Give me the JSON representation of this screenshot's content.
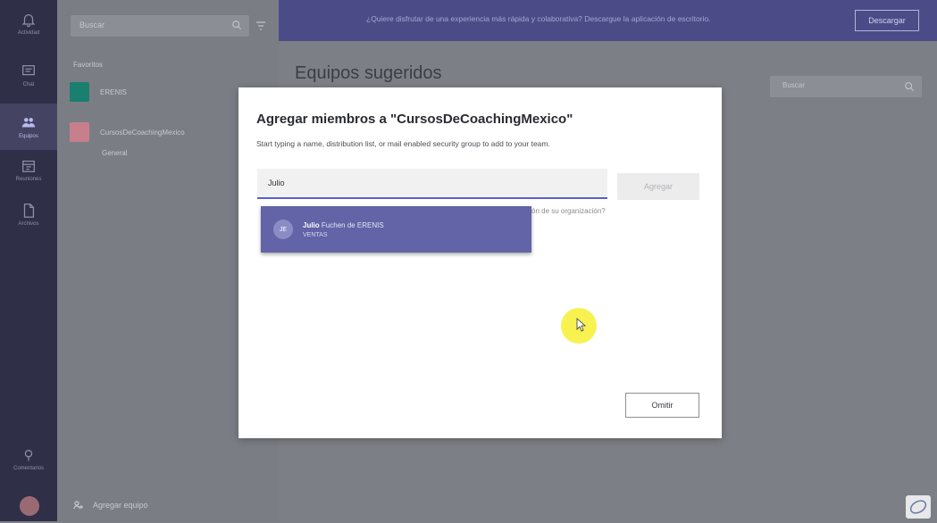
{
  "rail": {
    "items": [
      {
        "icon": "bell-icon",
        "label": "Actividad"
      },
      {
        "icon": "chat-icon",
        "label": "Chat"
      },
      {
        "icon": "teams-icon",
        "label": "Equipos"
      },
      {
        "icon": "meetings-icon",
        "label": "Reuniones"
      },
      {
        "icon": "files-icon",
        "label": "Archivos"
      },
      {
        "icon": "help-icon",
        "label": "Comentarios"
      }
    ]
  },
  "pane": {
    "search_placeholder": "Buscar",
    "favorites_label": "Favoritos",
    "teams": [
      {
        "name": "ERENIS",
        "color": "#1a7f6f"
      },
      {
        "name": "CursosDeCoachingMexico",
        "color": "#c77f8c"
      }
    ],
    "channel": "General",
    "add_team_label": "Agregar equipo"
  },
  "banner": {
    "text": "¿Quiere disfrutar de una experiencia más rápida y colaborativa? Descargue la aplicación de escritorio.",
    "button": "Descargar"
  },
  "main": {
    "title": "Equipos sugeridos",
    "search_placeholder": "Buscar"
  },
  "modal": {
    "title": "Agregar miembros a \"CursosDeCoachingMexico\"",
    "subtitle": "Start typing a name, distribution list, or mail enabled security group to add to your team.",
    "input_value": "Julio",
    "add_button": "Agregar",
    "hint": "ón de su organización?",
    "suggestion": {
      "initials": "JE",
      "first_name": "Julio",
      "rest_name": "Fuchen de ERENIS",
      "department": "VENTAS"
    },
    "skip_button": "Omitir"
  },
  "colors": {
    "accent": "#6264a7",
    "rail": "#2f3047",
    "banner": "#4b4c87"
  }
}
